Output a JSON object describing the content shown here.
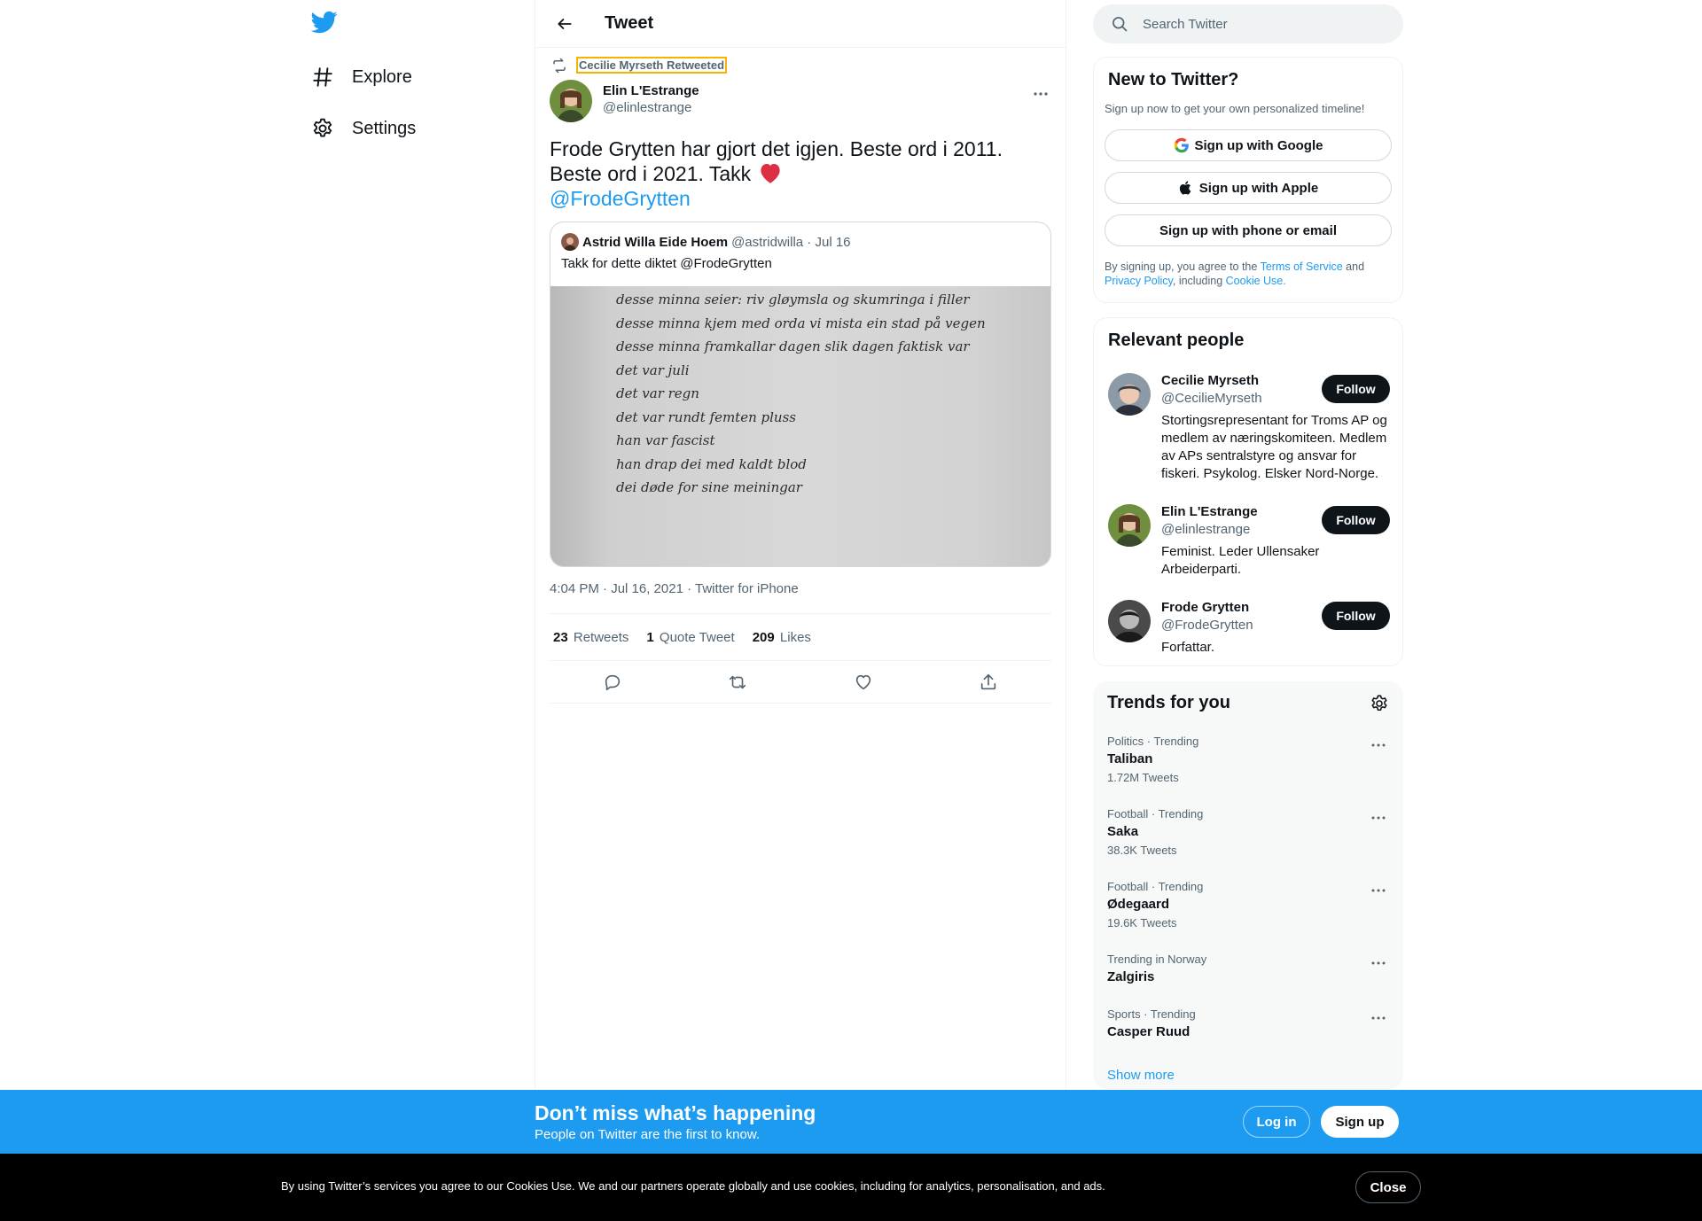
{
  "nav": {
    "logo": "twitter-bird-icon",
    "items": [
      {
        "label": "Explore",
        "icon": "hashtag-icon"
      },
      {
        "label": "Settings",
        "icon": "gear-icon"
      }
    ]
  },
  "header": {
    "title": "Tweet",
    "back_icon": "arrow-left-icon"
  },
  "tweet": {
    "retweeted_by": "Cecilie Myrseth Retweeted",
    "author_name": "Elin L'Estrange",
    "author_handle": "@elinlestrange",
    "text_line1": "Frode Grytten har gjort det igjen. Beste ord i 2011.",
    "text_line2": "Beste ord i 2021. Takk",
    "heart": "❤️",
    "mention": "@FrodeGrytten",
    "quote": {
      "name": "Astrid Willa Eide Hoem",
      "meta": "@astridwilla · Jul 16",
      "text": "Takk for dette diktet @FrodeGrytten",
      "poem": [
        "desse minna seier: riv gløymsla og skumringa i filler",
        "desse minna kjem med orda vi mista ein stad på vegen",
        "desse minna framkallar dagen slik dagen faktisk var",
        "det var juli",
        "det var regn",
        "det var rundt femten pluss",
        "han var fascist",
        "han drap dei med kaldt blod",
        "dei døde for sine meiningar"
      ]
    },
    "timestamp": "4:04 PM · Jul 16, 2021 · Twitter for iPhone",
    "stats": {
      "retweets_count": "23",
      "retweets_label": "Retweets",
      "quotes_count": "1",
      "quotes_label": "Quote Tweet",
      "likes_count": "209",
      "likes_label": "Likes"
    }
  },
  "search": {
    "placeholder": "Search Twitter"
  },
  "new_to_twitter": {
    "title": "New to Twitter?",
    "subtitle": "Sign up now to get your own personalized timeline!",
    "google": "Sign up with Google",
    "apple": "Sign up with Apple",
    "phone": "Sign up with phone or email",
    "terms_pre": "By signing up, you agree to the ",
    "terms_link": "Terms of Service",
    "terms_and": " and ",
    "privacy_link": "Privacy Policy",
    "terms_including": ", including ",
    "cookie_link": "Cookie Use."
  },
  "relevant_people": {
    "title": "Relevant people",
    "follow_label": "Follow",
    "people": [
      {
        "name": "Cecilie Myrseth",
        "handle": "@CecilieMyrseth",
        "bio": "Stortingsrepresentant for Troms AP og medlem av næringskomiteen. Medlem av APs sentralstyre og ansvar for fiskeri. Psykolog. Elsker Nord-Norge."
      },
      {
        "name": "Elin L'Estrange",
        "handle": "@elinlestrange",
        "bio": "Feminist. Leder Ullensaker Arbeiderparti."
      },
      {
        "name": "Frode Grytten",
        "handle": "@FrodeGrytten",
        "bio": "Forfattar."
      }
    ]
  },
  "trends": {
    "title": "Trends for you",
    "items": [
      {
        "category": "Politics · Trending",
        "name": "Taliban",
        "count": "1.72M Tweets"
      },
      {
        "category": "Football · Trending",
        "name": "Saka",
        "count": "38.3K Tweets"
      },
      {
        "category": "Football · Trending",
        "name": "Ødegaard",
        "count": "19.6K Tweets"
      },
      {
        "category": "Trending in Norway",
        "name": "Zalgiris",
        "count": ""
      },
      {
        "category": "Sports · Trending",
        "name": "Casper Ruud",
        "count": ""
      }
    ],
    "show_more": "Show more"
  },
  "login_bar": {
    "title": "Don’t miss what’s happening",
    "subtitle": "People on Twitter are the first to know.",
    "login": "Log in",
    "signup": "Sign up"
  },
  "cookie_bar": {
    "text": "By using Twitter’s services you agree to our Cookies Use. We and our partners operate globally and use cookies, including for analytics, personalisation, and ads.",
    "close": "Close"
  },
  "colors": {
    "accent": "#1d9bf0",
    "text": "#0f1419",
    "muted": "#536471",
    "cookie_bg": "#000000"
  }
}
